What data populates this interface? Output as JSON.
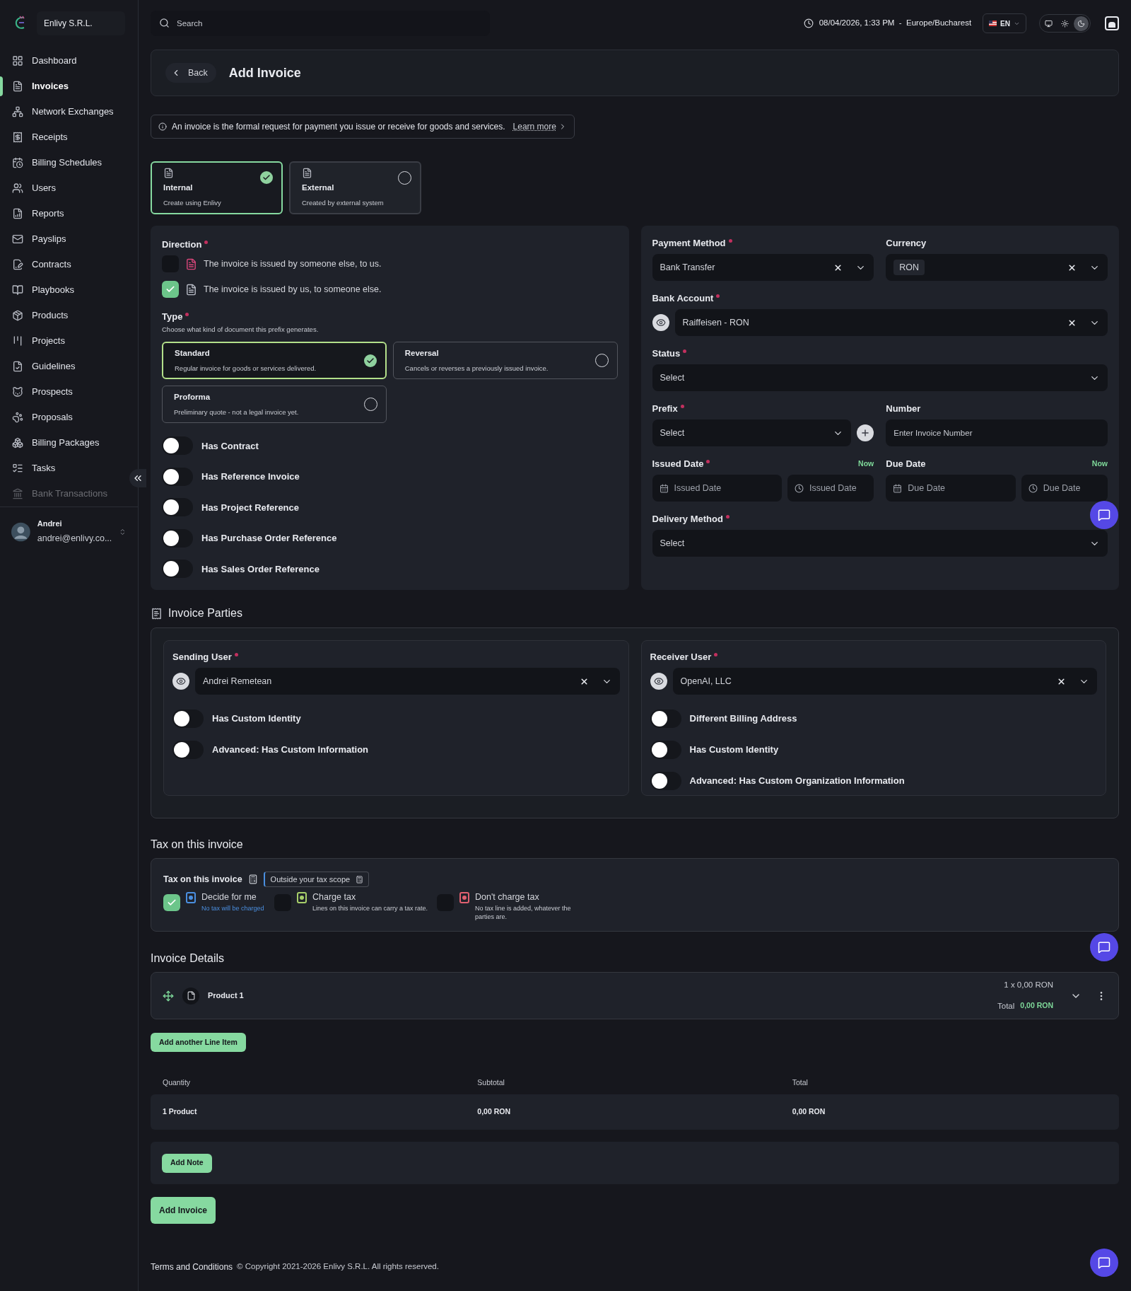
{
  "sidebar": {
    "company": "Enlivy S.R.L.",
    "items": [
      {
        "label": "Dashboard",
        "selected": false
      },
      {
        "label": "Invoices",
        "selected": true
      },
      {
        "label": "Network Exchanges",
        "selected": false
      },
      {
        "label": "Receipts",
        "selected": false
      },
      {
        "label": "Billing Schedules",
        "selected": false
      },
      {
        "label": "Users",
        "selected": false
      },
      {
        "label": "Reports",
        "selected": false
      },
      {
        "label": "Payslips",
        "selected": false
      },
      {
        "label": "Contracts",
        "selected": false
      },
      {
        "label": "Playbooks",
        "selected": false
      },
      {
        "label": "Products",
        "selected": false
      },
      {
        "label": "Projects",
        "selected": false
      },
      {
        "label": "Guidelines",
        "selected": false
      },
      {
        "label": "Prospects",
        "selected": false
      },
      {
        "label": "Proposals",
        "selected": false
      },
      {
        "label": "Billing Packages",
        "selected": false
      },
      {
        "label": "Tasks",
        "selected": false
      },
      {
        "label": "Bank Transactions",
        "selected": false
      }
    ],
    "user": {
      "name": "Andrei",
      "email": "andrei@enlivy.co..."
    }
  },
  "topbar": {
    "search_placeholder": "Search",
    "datetime": "08/04/2026, 1:33 PM  -  Europe/Bucharest",
    "language": "EN",
    "theme_modes": [
      {
        "kind": "system",
        "selected": false
      },
      {
        "kind": "light",
        "selected": false
      },
      {
        "kind": "dark",
        "selected": true
      }
    ]
  },
  "header": {
    "back": "Back",
    "title": "Add Invoice"
  },
  "info": {
    "text": "An invoice is the formal request for payment you issue or receive for goods and services.",
    "link": "Learn more"
  },
  "origin_options": [
    {
      "title": "Internal",
      "description": "Create using Enlivy",
      "selected": true
    },
    {
      "title": "External",
      "description": "Created by external system",
      "selected": false
    }
  ],
  "direction": {
    "label": "Direction",
    "required": true,
    "options": [
      {
        "text": "The invoice is issued by someone else, to us.",
        "checked": false,
        "color": "#d9467a"
      },
      {
        "text": "The invoice is issued by us, to someone else.",
        "checked": true,
        "color": "#b8bcc6"
      }
    ]
  },
  "type": {
    "label": "Type",
    "required": true,
    "hint": "Choose what kind of document this prefix generates.",
    "options": [
      {
        "title": "Standard",
        "description": "Regular invoice for goods or services delivered.",
        "selected": true
      },
      {
        "title": "Reversal",
        "description": "Cancels or reverses a previously issued invoice.",
        "selected": false
      },
      {
        "title": "Proforma",
        "description": "Preliminary quote - not a legal invoice yet.",
        "selected": false
      }
    ]
  },
  "toggles": [
    {
      "label": "Has Contract",
      "on": false
    },
    {
      "label": "Has Reference Invoice",
      "on": false
    },
    {
      "label": "Has Project Reference",
      "on": false
    },
    {
      "label": "Has Purchase Order Reference",
      "on": false
    },
    {
      "label": "Has Sales Order Reference",
      "on": false
    }
  ],
  "settings": {
    "payment_method": {
      "label": "Payment Method",
      "required": true,
      "value": "Bank Transfer"
    },
    "currency": {
      "label": "Currency",
      "required": false,
      "value": "RON"
    },
    "bank_account": {
      "label": "Bank Account",
      "required": true,
      "value": "Raiffeisen - RON"
    },
    "status": {
      "label": "Status",
      "required": true,
      "placeholder": "Select"
    },
    "prefix": {
      "label": "Prefix",
      "required": true,
      "placeholder": "Select"
    },
    "number": {
      "label": "Number",
      "required": false,
      "placeholder": "Enter Invoice Number"
    },
    "issued_date": {
      "label": "Issued Date",
      "required": true,
      "now": "Now",
      "date_placeholder": "Issued Date",
      "time_placeholder": "Issued Date"
    },
    "due_date": {
      "label": "Due Date",
      "required": false,
      "now": "Now",
      "date_placeholder": "Due Date",
      "time_placeholder": "Due Date"
    },
    "delivery_method": {
      "label": "Delivery Method",
      "required": true,
      "placeholder": "Select"
    }
  },
  "parties": {
    "heading": "Invoice Parties",
    "sides": [
      {
        "label": "Sending User",
        "required": true,
        "value": "Andrei Remetean",
        "toggles": [
          {
            "label": "Has Custom Identity",
            "on": false
          },
          {
            "label": "Advanced: Has Custom Information",
            "on": false
          }
        ]
      },
      {
        "label": "Receiver User",
        "required": true,
        "value": "OpenAI, LLC",
        "toggles": [
          {
            "label": "Different Billing Address",
            "on": false
          },
          {
            "label": "Has Custom Identity",
            "on": false
          },
          {
            "label": "Advanced: Has Custom Organization Information",
            "on": false
          }
        ]
      }
    ]
  },
  "tax": {
    "heading": "Tax on this invoice",
    "label": "Tax on this invoice",
    "scope": "Outside your tax scope",
    "options": [
      {
        "title": "Decide for me",
        "description": "No tax will be charged",
        "checked": true,
        "color": "#4a8fe0"
      },
      {
        "title": "Charge tax",
        "description": "Lines on this invoice can carry a tax rate.",
        "checked": false,
        "color": "#a7cf6a"
      },
      {
        "title": "Don't charge tax",
        "description": "No tax line is added, whatever the parties are.",
        "checked": false,
        "color": "#e06070"
      }
    ]
  },
  "details": {
    "heading": "Invoice Details",
    "line_items": [
      {
        "name": "Product 1",
        "unit": "1 x 0,00 RON",
        "total_label": "Total",
        "total": "0,00 RON"
      }
    ],
    "add_line": "Add another Line Item",
    "table": {
      "columns": [
        "Quantity",
        "Subtotal",
        "Total"
      ],
      "rows": [
        [
          "1 Product",
          "0,00 RON",
          "0,00 RON"
        ]
      ]
    },
    "add_note": "Add Note",
    "submit": "Add Invoice"
  },
  "footer": {
    "terms": "Terms and Conditions",
    "copyright": "© Copyright 2021-2026 Enlivy S.R.L. All rights reserved."
  }
}
